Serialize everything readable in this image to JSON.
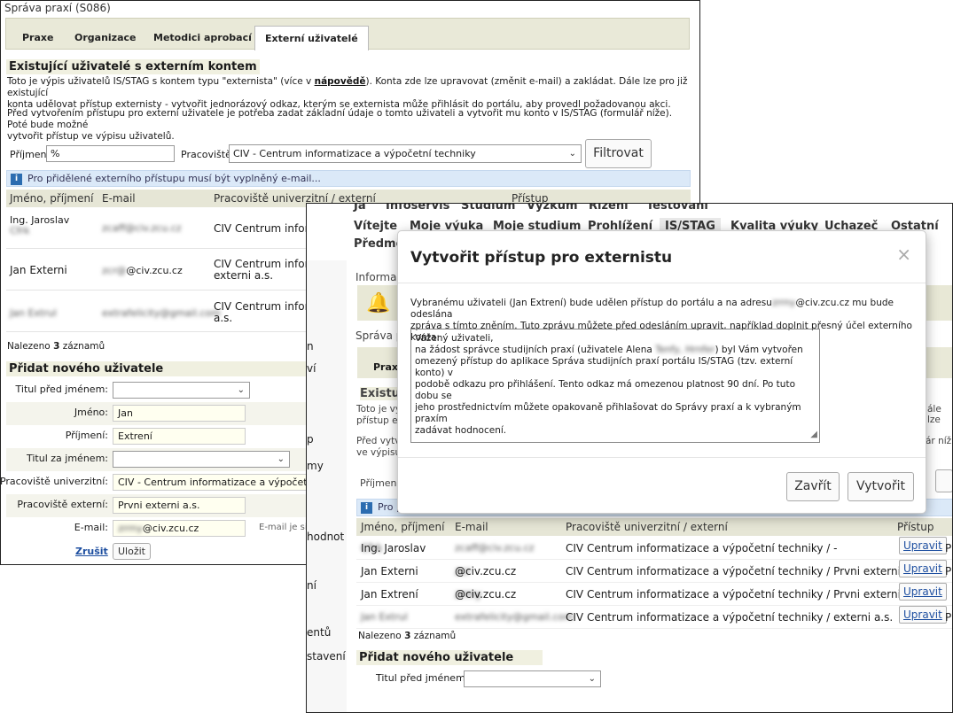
{
  "back": {
    "title": "Správa praxí (S086)",
    "tabs": [
      "Praxe",
      "Organizace",
      "Metodici aprobací",
      "Externí uživatelé"
    ],
    "heading": "Existující uživatelé s externím kontem",
    "para1a": "Toto je výpis uživatelů IS/STAG s kontem typu \"externista\" (více v ",
    "para1_link": "nápovědě",
    "para1b": "). Konta zde lze upravovat (změnit e-mail) a zakládat. Dále lze pro již existující",
    "para1c": "konta udělovat přístup externisty - vytvořit jednorázový odkaz, kterým se externista může přihlásit do portálu, aby provedl požadovanou akci.",
    "para2a": "Před vytvořením přístupu pro externí uživatele je potřeba zadat základní údaje o tomto uživateli a vytvořit mu konto v IS/STAG (formulář níže). Poté bude možné",
    "para2b": "vytvořit přístup ve výpisu uživatelů.",
    "filter": {
      "surname_label": "Příjmení",
      "surname_value": "%",
      "workplace_label": "Pracoviště",
      "workplace_value": "CIV - Centrum informatizace a výpočetní techniky",
      "button": "Filtrovat"
    },
    "info": "Pro přidělené externího přístupu musí být vyplněný e-mail...",
    "table_headers": [
      "Jméno, příjmení",
      "E-mail",
      "Pracoviště univerzitní / externí",
      "Přístup"
    ],
    "rows": [
      {
        "name1": "Ing. Jaroslav",
        "name2": "Cfrk",
        "email": "zcaff@civ.zcu.cz",
        "work1": "CIV Centrum inform",
        "work2": ""
      },
      {
        "name1": "Jan Externi",
        "name2": "",
        "email_blur": "zcr@",
        "email": "@civ.zcu.cz",
        "work1": "CIV Centrum inform",
        "work2": "externi a.s."
      },
      {
        "name1": "Jan Extrul",
        "name2": "",
        "email": "extrafelicity@gmail.com",
        "work1": "CIV Centrum inform",
        "work2": "a.s."
      }
    ],
    "count_prefix": "Nalezeno ",
    "count_num": "3",
    "count_suffix": " záznamů",
    "add_heading": "Přidat nového uživatele",
    "form": {
      "title_before": "Titul před jménem:",
      "first_name": "Jméno:",
      "first_name_value": "Jan",
      "surname": "Příjmení:",
      "surname_value": "Extrení",
      "title_after": "Titul za jménem:",
      "workplace_uni": "Pracoviště univerzitní:",
      "workplace_uni_value": "CIV - Centrum informatizace a výpočetní te",
      "workplace_ext": "Pracoviště externí:",
      "workplace_ext_value": "Prvni externi a.s.",
      "email": "E-mail:",
      "email_blur": "zrrny",
      "email_value": "@civ.zcu.cz",
      "email_note": "E-mail je sic",
      "cancel": "Zrušit",
      "save": "Uložit"
    }
  },
  "front": {
    "nav1": [
      "Já",
      "Infoservis",
      "Studium",
      "Výzkum",
      "Řízení",
      "Testování"
    ],
    "nav2": [
      "Vítejte",
      "Moje výuka",
      "Moje studium",
      "Prohlížení",
      "IS/STAG",
      "Kvalita výuky",
      "Uchazeč",
      "Ostatní"
    ],
    "nav3": "Předmě",
    "side_frags": [
      "n",
      "ví",
      "p",
      "my",
      "hodnot",
      "ní",
      "entů",
      "stavení"
    ],
    "frag_informac": "Informac",
    "frag_sprava": "Správa p",
    "frag_prax": "Prax",
    "frag_existuj": "Existuj",
    "frag_toto": "Toto je vy",
    "frag_pristup": "přístup ex",
    "frag_pred": "Před vytv",
    "frag_vevypisu": "ve výpisu",
    "frag_prijm": "Příjmení",
    "frag_pro": "Pro p",
    "frag_ale": "ále lze",
    "frag_ar": "ár níž",
    "table_headers": [
      "Jméno, příjmení",
      "E-mail",
      "Pracoviště univerzitní / externí",
      "Přístup"
    ],
    "rows": [
      {
        "name": "Ing. Jaroslav",
        "name_blur": "Cfrk",
        "email": "zcaff@civ.zcu.cz",
        "work": "CIV Centrum informatizace a výpočetní techniky / -",
        "btn": "Upravit",
        "tail": "P"
      },
      {
        "name": "Jan Externi",
        "email_blur": "zcr",
        "email": "@civ.zcu.cz",
        "work": "CIV Centrum informatizace a výpočetní techniky / Prvni externi a.s.",
        "btn": "Upravit",
        "tail": "P"
      },
      {
        "name": "Jan Extrení",
        "email_blur": "zrrny",
        "email": "@civ.zcu.cz",
        "work": "CIV Centrum informatizace a výpočetní techniky / Prvni externi a.s.",
        "btn": "Upravit",
        "tail": ""
      },
      {
        "name": "Jan Extrul",
        "email": "extrafelicity@gmail.com",
        "work": "CIV Centrum informatizace a výpočetní techniky / externi a.s.",
        "btn": "Upravit",
        "tail": "P"
      }
    ],
    "count_prefix": "Nalezeno ",
    "count_num": "3",
    "count_suffix": " záznamů",
    "add_heading": "Přidat nového uživatele",
    "title_before": "Titul před jménem:"
  },
  "modal": {
    "title": "Vytvořit přístup pro externistu",
    "close": "×",
    "intro1a": "Vybranému uživateli (Jan Extrení) bude udělen přístup do portálu a na adresu",
    "intro1_blur": "zrrny",
    "intro1b": "@civ.zcu.cz mu bude odeslána",
    "intro2": "zpráva s tímto zněním. Tuto zprávu můžete před odesláním upravit, například doplnit přesný účel externího konta:",
    "message_line1": "Vážený uživateli,",
    "message_line2a": "na žádost správce studijních praxí (uživatele Alena ",
    "message_line2_blur": "Tenfy, Hrnfer",
    "message_line2b": ") byl Vám vytvořen",
    "message_rest": "omezený přístup do aplikace Správa studijních praxí portálu IS/STAG (tzv. externí konto) v\npodobě odkazu pro přihlášení. Tento odkaz má omezenou platnost 90 dní. Po tuto dobu se\njeho prostřednictvím můžete opakovaně přihlašovat do Správy praxí a k vybraným praxím\nzadávat hodnocení.",
    "btn_close": "Zavřít",
    "btn_create": "Vytvořit"
  }
}
